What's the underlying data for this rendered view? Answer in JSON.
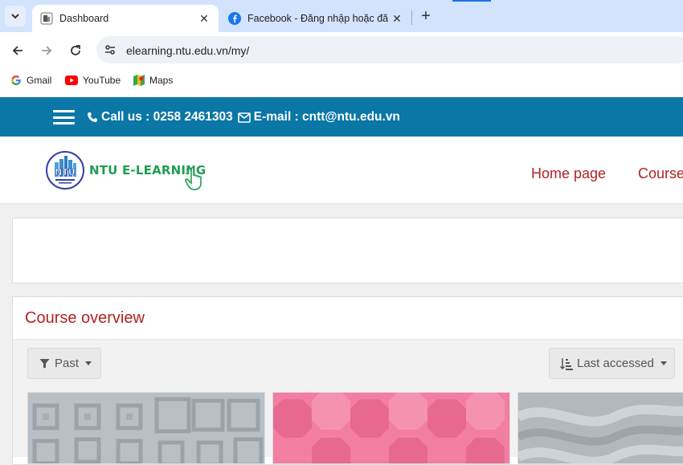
{
  "browser": {
    "tabs": [
      {
        "title": "Dashboard",
        "close": "✕"
      },
      {
        "title": "Facebook - Đăng nhập hoặc đă",
        "close": "✕"
      }
    ],
    "new_tab": "+",
    "url": "elearning.ntu.edu.vn/my/",
    "bookmarks": [
      "Gmail",
      "YouTube",
      "Maps"
    ]
  },
  "site": {
    "contact_phone": "Call us : 0258 2461303",
    "contact_email": "E-mail : cntt@ntu.edu.vn",
    "logo_text": "NTU E-LEARNING",
    "logo_initials": "NTU",
    "nav": [
      "Home page",
      "Course"
    ]
  },
  "course_overview": {
    "title": "Course overview",
    "filter": "Past",
    "sort": "Last accessed"
  },
  "colors": {
    "topbar": "#0a77a6",
    "accent_red": "#b22222",
    "logo_green": "#1f9e52"
  }
}
